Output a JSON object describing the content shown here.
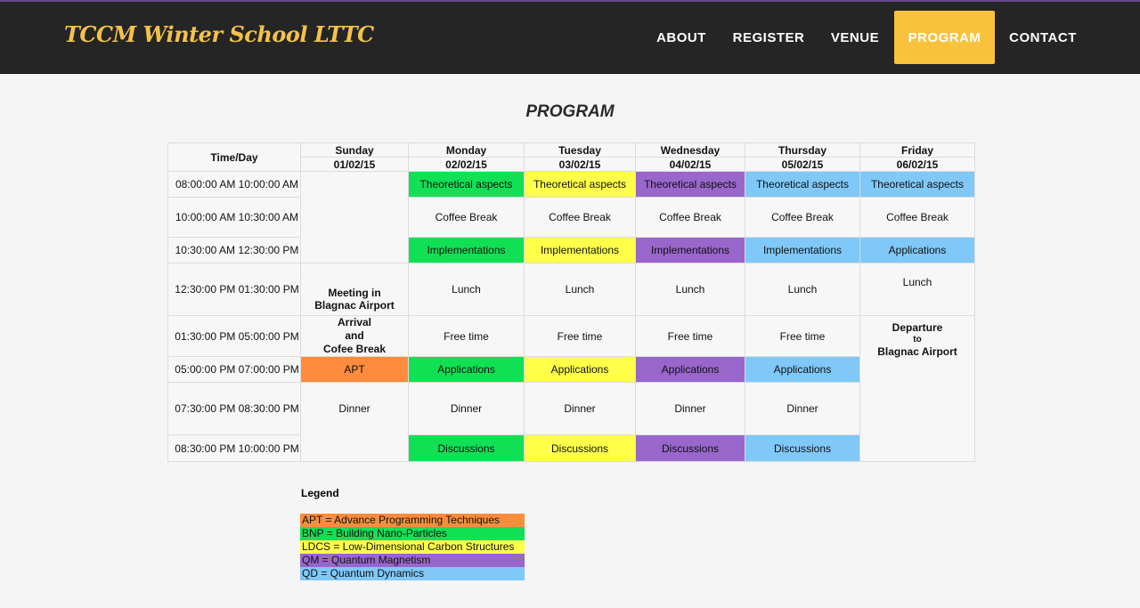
{
  "brand": "TCCM Winter School LTTC",
  "nav": [
    {
      "label": "ABOUT"
    },
    {
      "label": "REGISTER"
    },
    {
      "label": "VENUE"
    },
    {
      "label": "PROGRAM",
      "active": true
    },
    {
      "label": "CONTACT"
    }
  ],
  "page_title": "PROGRAM",
  "colors": {
    "navbar_bg": "#252525",
    "brand": "#f4c24a",
    "nav_active": "#f9c23c",
    "APT": "#ff8c3c",
    "BNP": "#11e055",
    "LDCS": "#ffff4a",
    "QM": "#9966cc",
    "QD": "#7fc8f8"
  },
  "table": {
    "time_header": "Time/Day",
    "days": [
      {
        "name": "Sunday",
        "date": "01/02/15"
      },
      {
        "name": "Monday",
        "date": "02/02/15"
      },
      {
        "name": "Tuesday",
        "date": "03/02/15"
      },
      {
        "name": "Wednesday",
        "date": "04/02/15"
      },
      {
        "name": "Thursday",
        "date": "05/02/15"
      },
      {
        "name": "Friday",
        "date": "06/02/15"
      }
    ],
    "times": [
      "08:00:00 AM  10:00:00 AM",
      "10:00:00 AM   10:30:00 AM",
      "10:30:00 AM  12:30:00 PM",
      "12:30:00 PM  01:30:00 PM",
      "01:30:00 PM  05:00:00 PM",
      "05:00:00 PM  07:00:00 PM",
      "07:30:00 PM  08:30:00 PM",
      "08:30:00 PM  10:00:00 PM"
    ],
    "sunday": {
      "meeting": [
        "Meeting in",
        "Blagnac Airport"
      ],
      "arrival": [
        "Arrival",
        "and",
        "Cofee Break"
      ],
      "apt": "APT",
      "dinner": "Dinner"
    },
    "week": {
      "theoretical": "Theoretical aspects",
      "coffee": "Coffee Break",
      "implementations": "Implementations",
      "applications": "Applications",
      "lunch": "Lunch",
      "free_time": "Free time",
      "dinner": "Dinner",
      "discussions": "Discussions"
    },
    "friday": {
      "theoretical": "Theoretical aspects",
      "coffee": "Coffee Break",
      "applications": "Applications",
      "lunch": "Lunch",
      "departure": [
        "Departure",
        "to",
        "Blagnac Airport"
      ]
    }
  },
  "legend": {
    "title": "Legend",
    "items": [
      {
        "text": "APT = Advance Programming Techniques",
        "color": "#ff8c3c"
      },
      {
        "text": "BNP = Building Nano-Particles",
        "color": "#11e055"
      },
      {
        "text": "LDCS = Low-Dimensional Carbon Structures",
        "color": "#ffff4a"
      },
      {
        "text": "QM = Quantum Magnetism",
        "color": "#9966cc"
      },
      {
        "text": "QD = Quantum Dynamics",
        "color": "#7fc8f8"
      }
    ]
  }
}
